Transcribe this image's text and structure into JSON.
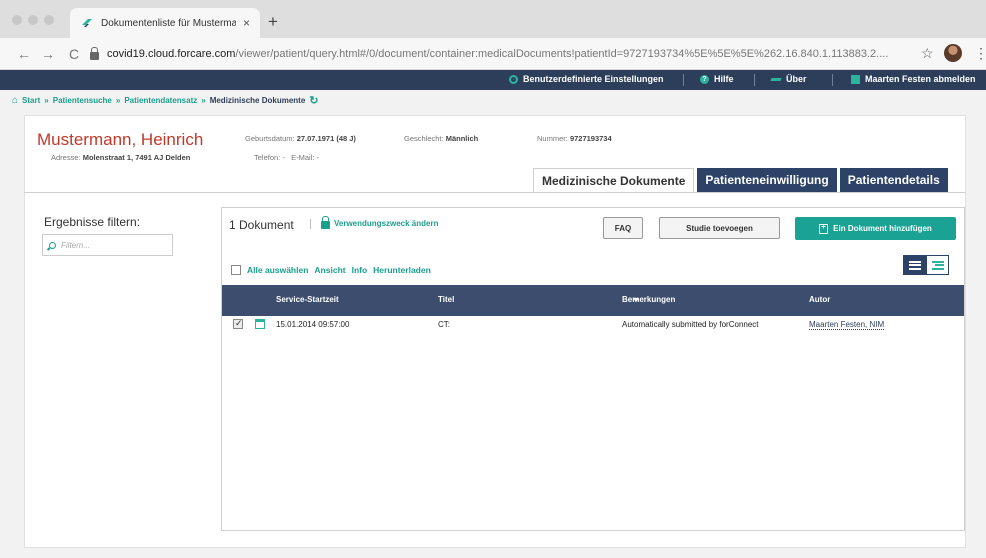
{
  "browser": {
    "tab_title": "Dokumentenliste für Musterman",
    "tab_close": "×",
    "new_tab": "+",
    "back": "←",
    "forward": "→",
    "reload": "C",
    "url_host": "covid19.cloud.forcare.com",
    "url_path": "/viewer/patient/query.html#/0/document/container:medicalDocuments!patientId=9727193734%5E%5E%5E%262.16.840.1.113883.2....",
    "star": "☆",
    "menu": "⋮"
  },
  "appbar": {
    "settings": "Benutzerdefinierte Einstellungen",
    "help": "Hilfe",
    "about": "Über",
    "logout": "Maarten Festen abmelden"
  },
  "breadcrumb": {
    "home": "Start",
    "sep": "»",
    "items": [
      "Patientensuche",
      "Patientendatensatz"
    ],
    "current": "Medizinische Dokumente"
  },
  "patient": {
    "name": "Mustermann, Heinrich",
    "address_label": "Adresse:",
    "address": "Molenstraat 1, 7491 AJ Delden",
    "dob_label": "Geburtsdatum:",
    "dob": "27.07.1971 (48 J)",
    "gender_label": "Geschlecht:",
    "gender": "Männlich",
    "number_label": "Nummer:",
    "number": "9727193734",
    "phone_label": "Telefon:",
    "phone": "-",
    "email_label": "E-Mail:",
    "email": "-"
  },
  "tabs": [
    "Medizinische Dokumente",
    "Patienteneinwilligung",
    "Patientendetails"
  ],
  "filter": {
    "title": "Ergebnisse filtern:",
    "placeholder": "Filtern..."
  },
  "documents": {
    "count": "1 Dokument",
    "purpose_link": "Verwendungszweck ändern",
    "faq": "FAQ",
    "study": "Studie toevoegen",
    "add": "Ein Dokument hinzufügen",
    "select_all": "Alle auswählen",
    "actions": [
      "Ansicht",
      "Info",
      "Herunterladen"
    ],
    "columns": [
      "Service-Startzeit",
      "Titel",
      "Bemerkungen",
      "Autor"
    ],
    "rows": [
      {
        "date": "15.01.2014 09:57:00",
        "title": "CT:",
        "remarks": "Automatically submitted by forConnect",
        "author": "Maarten Festen, NIM"
      }
    ]
  }
}
